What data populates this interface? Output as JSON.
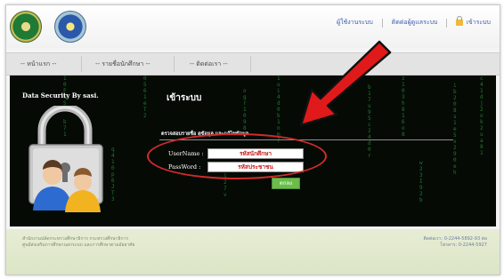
{
  "header": {
    "links": [
      "ผู้ใช้งานระบบ",
      "ติดต่อผู้ดูแลระบบ",
      "เข้าระบบ"
    ]
  },
  "nav": {
    "items": [
      "-- หน้าแรก --",
      "-- รายชื่อนักศึกษา --",
      "-- ติดต่อเรา --"
    ]
  },
  "banner": {
    "ds_title": "Data Security By sasi.",
    "login_title": "เข้าระบบ",
    "login_sub": "ตรวจสอบรายชื่อ ดูข้อมูล และแก้ไขข้อมูล",
    "username_label": "UserName :",
    "username_value": "รหัสนักศึกษา",
    "password_label": "PassWord :",
    "password_value": "รหัสประชาชน",
    "submit_label": "ตกลง"
  },
  "footer": {
    "left_lines": [
      "สำนักงานปลัดกระทรวงศึกษาธิการ กระทรวงศึกษาธิการ",
      "ศูนย์ส่งเสริมการศึกษานอกระบบ และการศึกษาตามอัธยาศัย"
    ],
    "right_lines": [
      "ติดต่อเรา: 0-2244-5892-93 ต่อ",
      "โทรสาร: 0-2244-5927"
    ]
  },
  "colors": {
    "accent_red": "#d12b2b",
    "button_green": "#6bbc4a",
    "matrix_green": "#2f9a3f"
  }
}
